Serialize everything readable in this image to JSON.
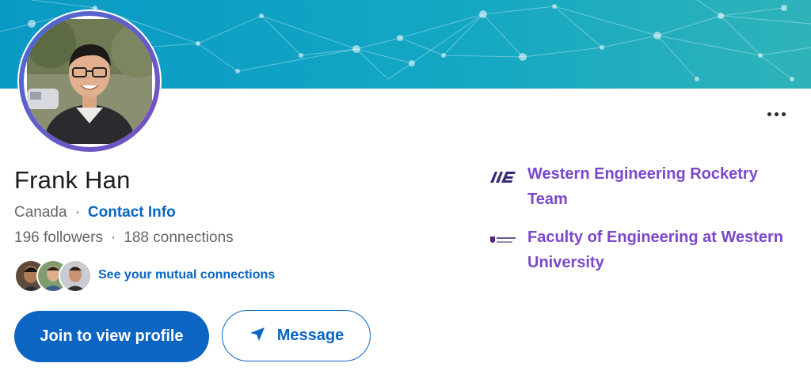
{
  "profile": {
    "name": "Frank Han",
    "location": "Canada",
    "separator": "·",
    "contact_label": "Contact Info",
    "followers": "196 followers",
    "connections": "188 connections",
    "mutual_label": "See your mutual connections"
  },
  "actions": {
    "join_label": "Join to view profile",
    "message_label": "Message"
  },
  "organizations": [
    {
      "name": "Western Engineering Rocketry Team",
      "logo": "rocketry-logo"
    },
    {
      "name": "Faculty of Engineering at Western University",
      "logo": "western-logo"
    }
  ],
  "colors": {
    "accent": "#0a66c2",
    "org_link": "#7a48c9",
    "banner": "#0a99c4"
  },
  "icons": {
    "more": "more-icon",
    "message": "send-icon"
  }
}
